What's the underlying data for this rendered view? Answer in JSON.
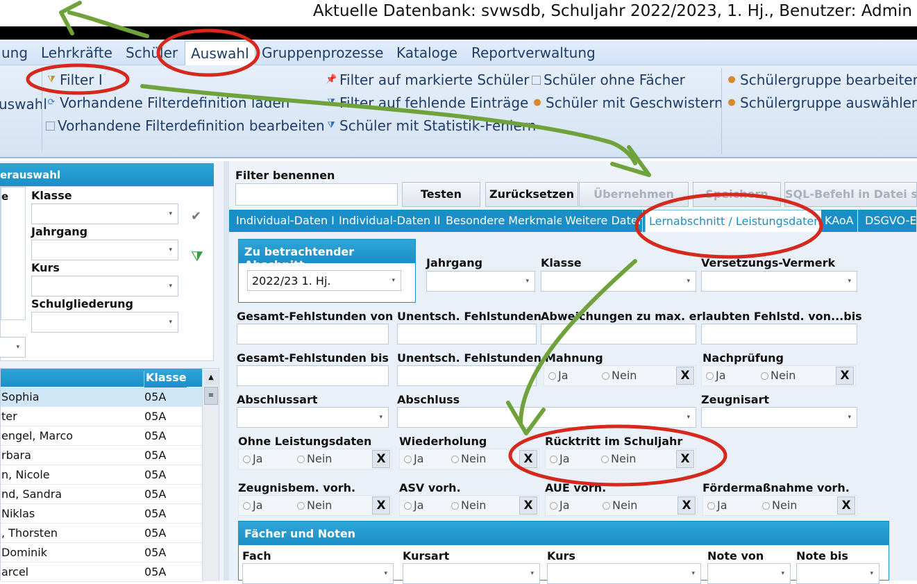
{
  "window": {
    "title": "Aktuelle Datenbank: svwsdb, Schuljahr 2022/2023, 1. Hj., Benutzer: Admin"
  },
  "menu": [
    "ung",
    "Lehrkräfte",
    "Schüler",
    "Auswahl",
    "Gruppenprozesse",
    "Kataloge",
    "Reportverwaltung"
  ],
  "ribbon": {
    "col0": [
      "uswahl"
    ],
    "col1": [
      "Filter I",
      "Vorhandene Filterdefinition laden",
      "Vorhandene Filterdefinition bearbeiten"
    ],
    "col2": [
      "Filter auf markierte Schüler",
      "Filter auf fehlende Einträge",
      "Schüler mit Statistik-Fehlern"
    ],
    "col3": [
      "Schüler ohne Fächer",
      "Schüler mit Geschwistern"
    ],
    "col4": [
      "Schülergruppe bearbeiten",
      "Schülergruppe auswählen"
    ]
  },
  "left": {
    "panel_title": "erauswahl",
    "left_label": "e",
    "fields": [
      "Klasse",
      "Jahrgang",
      "Kurs",
      "Schulgliederung"
    ],
    "grid_header": "Klasse",
    "rows": [
      {
        "name": "Sophia",
        "klasse": "05A"
      },
      {
        "name": "ter",
        "klasse": "05A"
      },
      {
        "name": "engel, Marco",
        "klasse": "05A"
      },
      {
        "name": "rbara",
        "klasse": "05A"
      },
      {
        "name": "n, Nicole",
        "klasse": "05A"
      },
      {
        "name": "nd, Sandra",
        "klasse": "05A"
      },
      {
        "name": "Niklas",
        "klasse": "05A"
      },
      {
        "name": ", Thorsten",
        "klasse": "05A"
      },
      {
        "name": "Dominik",
        "klasse": "05A"
      },
      {
        "name": "arcel",
        "klasse": "05A"
      }
    ]
  },
  "filter": {
    "name_label": "Filter benennen",
    "buttons": {
      "test": "Testen",
      "reset": "Zurücksetzen",
      "apply": "Übernehmen",
      "save": "Speichern",
      "sql": "SQL-Befehl in Datei sp"
    },
    "tabs": [
      "Individual-Daten I",
      "Individual-Daten II",
      "Besondere Merkmale",
      "Weitere Daten",
      "Lernabschnitt / Leistungsdaten",
      "KAoA",
      "DSGVO-E"
    ],
    "abschnitt_title": "Zu betrachtender Abschnitt",
    "abschnitt_value": "2022/23 1. Hj.",
    "labels": {
      "jahrgang": "Jahrgang",
      "klasse": "Klasse",
      "versetzung": "Versetzungs-Vermerk",
      "gfs_von": "Gesamt-Fehlstunden von",
      "ufs_1": "Unentsch. Fehlstunden",
      "abw": "Abweichungen zu max. erlaubten Fehlstd. von...bis",
      "gfs_bis": "Gesamt-Fehlstunden bis",
      "ufs_2": "Unentsch. Fehlstunden",
      "mahnung": "Mahnung",
      "nachpruefung": "Nachprüfung",
      "abschlussart": "Abschlussart",
      "abschluss": "Abschluss",
      "zeugnisart": "Zeugnisart",
      "ohne_ld": "Ohne Leistungsdaten",
      "wiederholung": "Wiederholung",
      "ruecktritt": "Rücktritt im Schuljahr",
      "zeugnisbem": "Zeugnisbem.  vorh.",
      "asv": "ASV vorh.",
      "aue": "AUE vorh.",
      "foerder": "Fördermaßnahme vorh."
    },
    "ja": "Ja",
    "nein": "Nein",
    "clear": "X",
    "faecher_title": "Fächer und Noten",
    "faecher_cols": [
      "Fach",
      "Kursart",
      "Kurs",
      "Note von",
      "Note bis"
    ]
  },
  "colors": {
    "accent": "#1a8fc7",
    "annotation_red": "#d6281c",
    "annotation_green": "#6fa23a"
  }
}
